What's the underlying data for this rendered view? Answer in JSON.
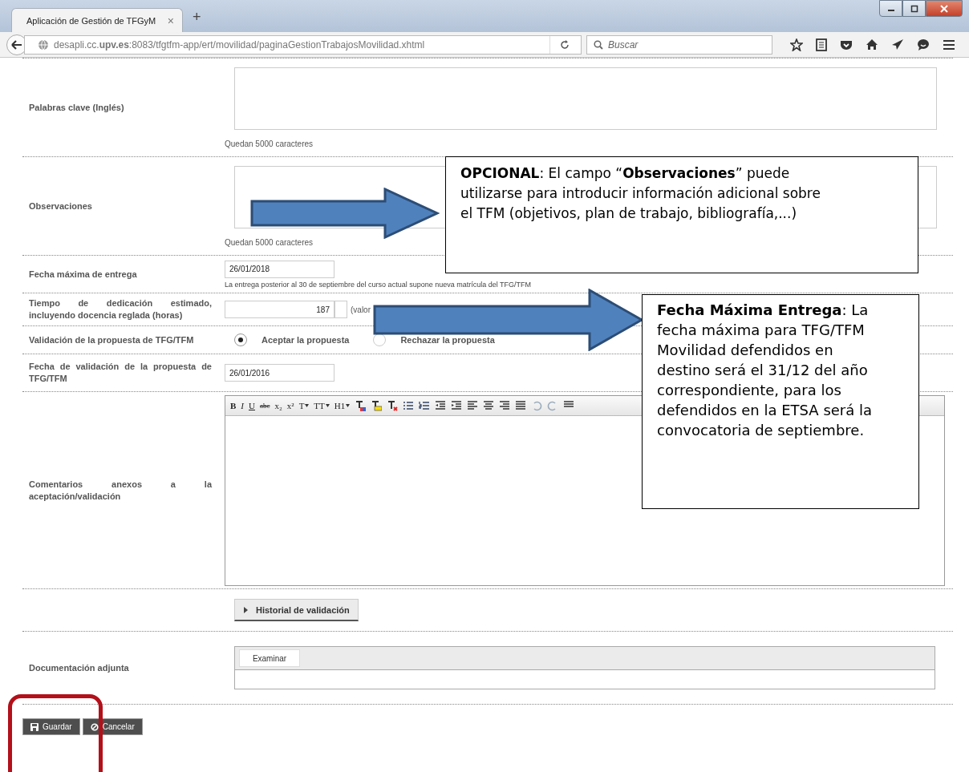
{
  "window": {
    "tab_title": "Aplicación de Gestión de TFGyM",
    "tab_close": "×",
    "new_tab": "+"
  },
  "address_bar": {
    "url": "desapli.cc.**upv.es**:8083/tfgtfm-app/ert/movilidad/paginaGestionTrabajosMovilidad.xhtml"
  },
  "search": {
    "placeholder": "Buscar"
  },
  "form": {
    "rows": [
      {
        "kind": "textarea",
        "label": "Palabras clave (Inglés)",
        "counter": "Quedan 5000 caracteres"
      },
      {
        "kind": "textarea",
        "label": "Observaciones",
        "counter": "Quedan 5000 caracteres"
      },
      {
        "kind": "date",
        "label": "Fecha máxima de entrega",
        "value": "26/01/2018",
        "hint": "La entrega posterior al 30 de septiembre del curso actual supone nueva matrícula del TFG/TFM"
      },
      {
        "kind": "number",
        "label": "Tiempo de dedicación estimado, incluyendo docencia reglada (horas)",
        "value": "187",
        "note": "(valor"
      },
      {
        "kind": "radio",
        "label": "Validación de la propuesta de TFG/TFM",
        "options": [
          {
            "label": "Aceptar la propuesta",
            "selected": true
          },
          {
            "label": "Rechazar la propuesta",
            "selected": false
          }
        ]
      },
      {
        "kind": "date",
        "label": "Fecha de validación de la propuesta de TFG/TFM",
        "value": "26/01/2016"
      },
      {
        "kind": "editor",
        "label": "Comentarios anexos a la aceptación/validación",
        "toolbar": [
          "B",
          "I",
          "U",
          "abc",
          "x₂",
          "x²",
          "T",
          "TT",
          "H1"
        ]
      },
      {
        "kind": "toggle",
        "button": "Historial de validación",
        "expanded": false
      },
      {
        "kind": "file",
        "label": "Documentación adjunta",
        "button": "Examinar"
      }
    ]
  },
  "actions": [
    {
      "kind": "save",
      "label": "Guardar"
    },
    {
      "kind": "cancel",
      "label": "Cancelar"
    }
  ],
  "annotations": {
    "callouts": [
      {
        "text": "**OPCIONAL**: El campo “**Observaciones**” puede utilizarse para introducir información adicional sobre el TFM (objetivos, plan de trabajo, bibliografía,...)"
      },
      {
        "text": "**Fecha Máxima Entrega**: La fecha máxima para TFG/TFM Movilidad defendidos en destino será el 31/12 del año correspondiente, para los defendidos en la ETSA será la convocatoria de septiembre."
      }
    ]
  }
}
